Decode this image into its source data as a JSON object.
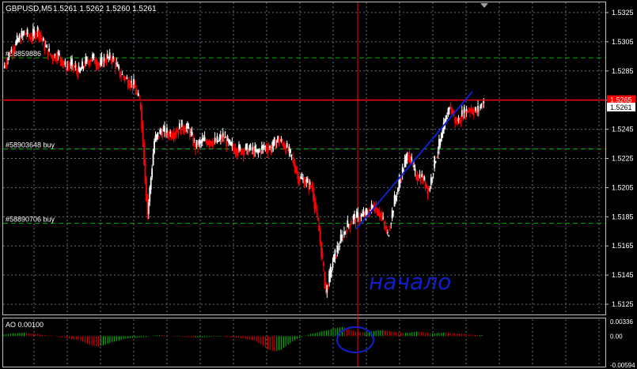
{
  "header": {
    "symbol": "GBPUSD,M5",
    "quote": "1.5261 1.5262 1.5260 1.5261"
  },
  "price_axis": {
    "ticks": [
      "1.5325",
      "1.5305",
      "1.5285",
      "1.5265",
      "1.5245",
      "1.5225",
      "1.5205",
      "1.5185",
      "1.5165",
      "1.5145",
      "1.5125"
    ],
    "current_price": "1.5261",
    "line_price": "1.5265"
  },
  "ao_panel": {
    "label": "AO 0.00100",
    "ticks": [
      "0.00336",
      "0.00",
      "-0.00594"
    ]
  },
  "orders": [
    {
      "label": "#58859886",
      "price": 1.5294
    },
    {
      "label": "#58903648 buy",
      "price": 1.52315
    },
    {
      "label": "#58890706 buy",
      "price": 1.51805
    }
  ],
  "annotation_text": "начало",
  "colors": {
    "background": "#000000",
    "grid": "#607080",
    "text": "#ffffff",
    "bull": "#ffffff",
    "bear": "#ff0000",
    "horizontal_line": "#ff0000",
    "vertical_line": "#ff0000",
    "order_line": "#00b000",
    "annotation": "#1020c8",
    "ao_up": "#00aa00",
    "ao_down": "#cc0000"
  },
  "chart_data": {
    "type": "line",
    "title": "GBPUSD,M5",
    "ylim": [
      1.5118,
      1.5332
    ],
    "horizontal_line": 1.5265,
    "current_price": 1.5261,
    "series": [
      {
        "name": "GBPUSD,M5",
        "values": [
          1.5287,
          1.5298,
          1.5305,
          1.5311,
          1.5308,
          1.5313,
          1.5302,
          1.5295,
          1.5296,
          1.5288,
          1.5289,
          1.5284,
          1.5291,
          1.5294,
          1.5289,
          1.5294,
          1.5293,
          1.5283,
          1.5279,
          1.5275,
          1.5261,
          1.5187,
          1.5237,
          1.5244,
          1.5242,
          1.5243,
          1.5247,
          1.5245,
          1.5233,
          1.5237,
          1.5237,
          1.5236,
          1.524,
          1.5234,
          1.5231,
          1.5231,
          1.5231,
          1.5229,
          1.5233,
          1.5232,
          1.5238,
          1.5234,
          1.5226,
          1.5212,
          1.5209,
          1.5205,
          1.5175,
          1.5133,
          1.5154,
          1.5167,
          1.5178,
          1.5184,
          1.5185,
          1.5187,
          1.5193,
          1.5186,
          1.5172,
          1.5196,
          1.5214,
          1.5229,
          1.5214,
          1.5212,
          1.5203,
          1.5226,
          1.5242,
          1.5262,
          1.5249,
          1.5256,
          1.5259,
          1.5257,
          1.5264
        ]
      }
    ],
    "ao_values": [
      0.0003,
      0.0005,
      0.0006,
      0.0007,
      0.0005,
      0.0004,
      0.0002,
      0.0001,
      -0.0002,
      -0.0003,
      -0.0006,
      -0.0008,
      -0.0013,
      -0.0019,
      -0.0021,
      -0.0017,
      -0.0012,
      -0.0009,
      -0.0005,
      -0.0004,
      -0.0003,
      -0.0002,
      0.0001,
      0.0002,
      0.0001,
      -0.0001,
      -0.0001,
      -0.0002,
      -0.0003,
      -0.0003,
      -0.0002,
      -0.0001,
      -0.0001,
      -0.0002,
      -0.0003,
      -0.0004,
      -0.0006,
      -0.0009,
      -0.0017,
      -0.0026,
      -0.0031,
      -0.0027,
      -0.0017,
      -0.0008,
      -0.0002,
      0.0003,
      0.0006,
      0.001,
      0.0012,
      0.0016,
      0.0018,
      0.0014,
      0.0009,
      0.0007,
      0.0008,
      0.0011,
      0.0012,
      0.001,
      0.0008,
      0.0006,
      0.0007,
      0.0009,
      0.0008,
      0.0005,
      0.0006,
      0.0007,
      0.0006,
      0.0005,
      0.0004,
      0.0003,
      0.0002
    ],
    "ao_ylim": [
      -0.00594,
      0.00336
    ]
  }
}
